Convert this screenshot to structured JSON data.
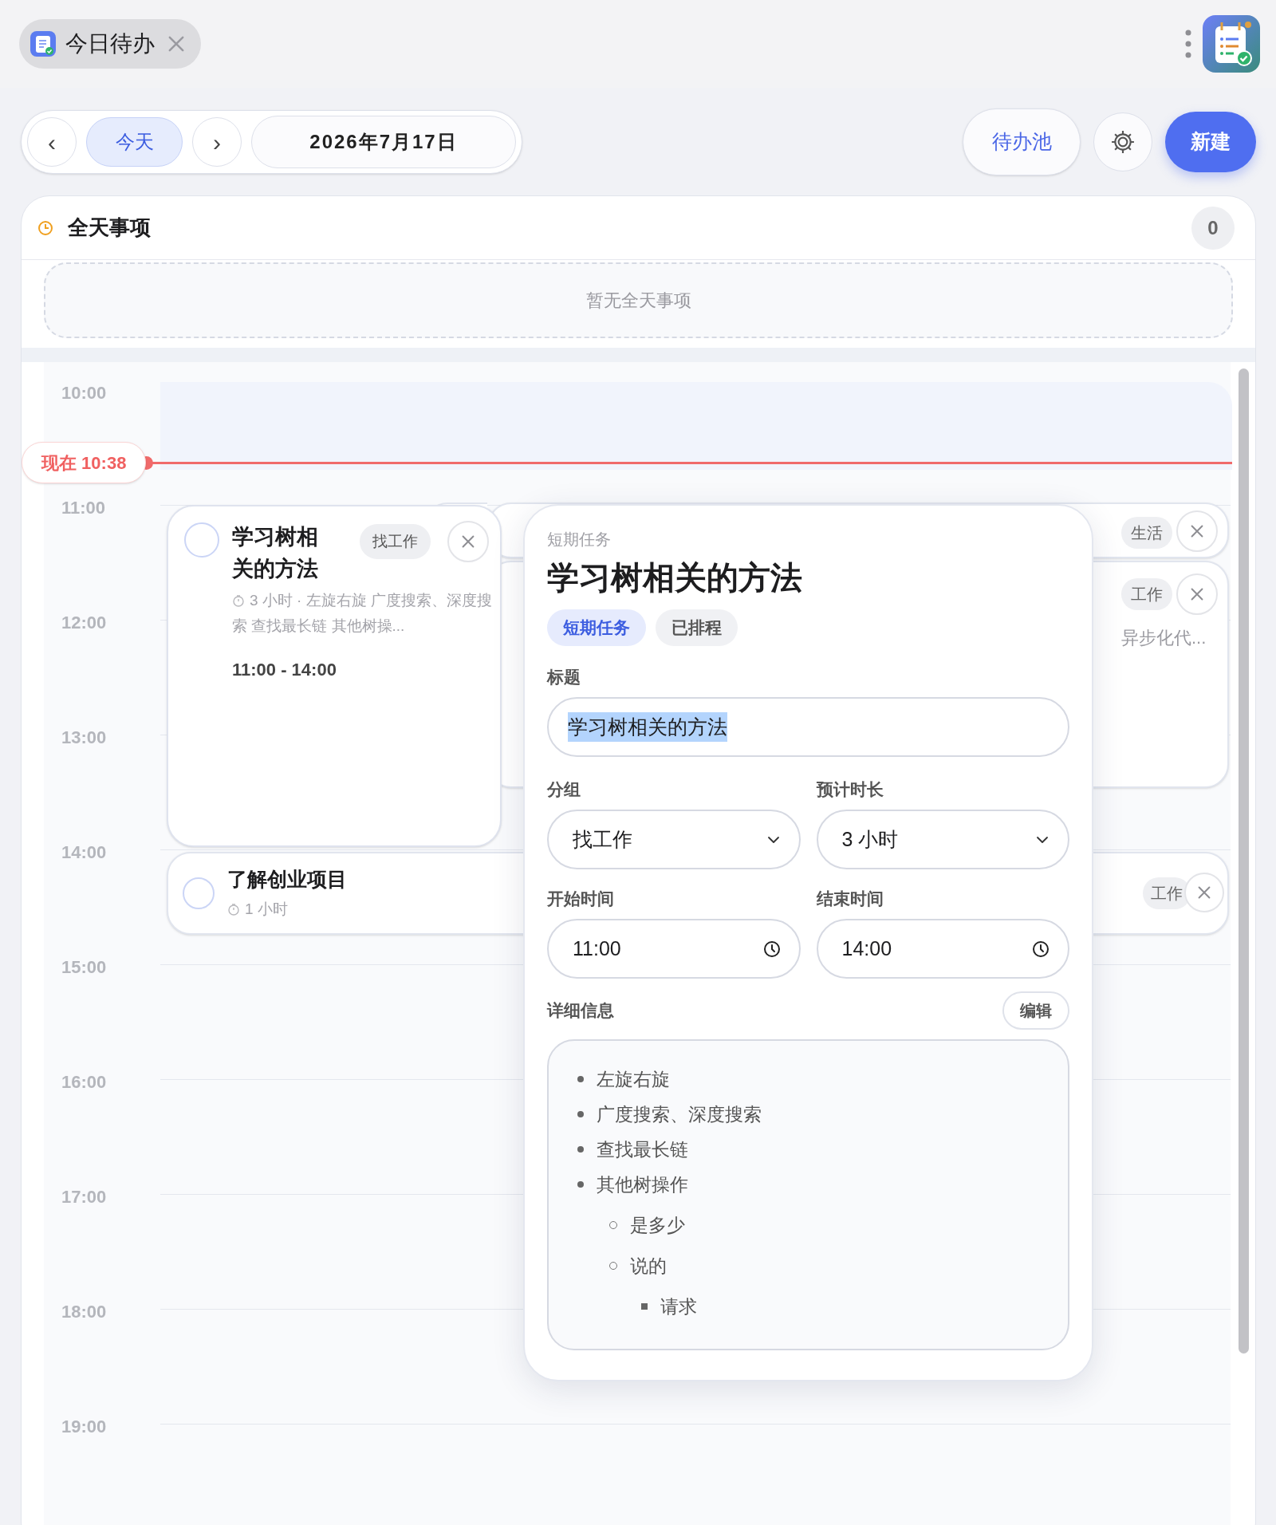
{
  "tab": {
    "title": "今日待办"
  },
  "toolbar": {
    "prev": "‹",
    "today": "今天",
    "next": "›",
    "date": "2026年7月17日",
    "pool": "待办池",
    "new": "新建"
  },
  "all_day": {
    "title": "全天事项",
    "count": "0",
    "empty": "暂无全天事项"
  },
  "timeline": {
    "hours": [
      "10:00",
      "11:00",
      "12:00",
      "13:00",
      "14:00",
      "15:00",
      "16:00",
      "17:00",
      "18:00",
      "19:00"
    ],
    "now_label": "现在 10:38"
  },
  "events": [
    {
      "title": "学习树相关的方法",
      "tag": "找工作",
      "duration": "3 小时",
      "summary": "· 左旋右旋 广度搜索、深度搜索 查找最长链 其他树操...",
      "time": "11:00 - 14:00",
      "done": false
    },
    {
      "title": "了解创业项目",
      "tag": "工作",
      "duration": "1 小时",
      "done": false
    }
  ],
  "behind_cards": [
    {
      "tag": "生活"
    },
    {
      "tag": "工作",
      "snippet": "异步化代..."
    }
  ],
  "popover": {
    "kind_label": "短期任务",
    "title": "学习树相关的方法",
    "chips": [
      {
        "label": "短期任务",
        "kind": "type"
      },
      {
        "label": "已排程",
        "kind": "status"
      }
    ],
    "title_label": "标题",
    "title_value": "学习树相关的方法",
    "title_text_selected": true,
    "group_label": "分组",
    "group_value": "找工作",
    "duration_label": "预计时长",
    "duration_value": "3 小时",
    "start_label": "开始时间",
    "start_value": "11:00",
    "end_label": "结束时间",
    "end_value": "14:00",
    "details_label": "详细信息",
    "edit": "编辑",
    "notes": [
      {
        "text": "左旋右旋"
      },
      {
        "text": "广度搜索、深度搜索"
      },
      {
        "text": "查找最长链"
      },
      {
        "text": "其他树操作",
        "children": [
          {
            "text": "是多少"
          },
          {
            "text": "说的",
            "children": [
              {
                "text": "请求"
              }
            ]
          }
        ]
      }
    ]
  }
}
